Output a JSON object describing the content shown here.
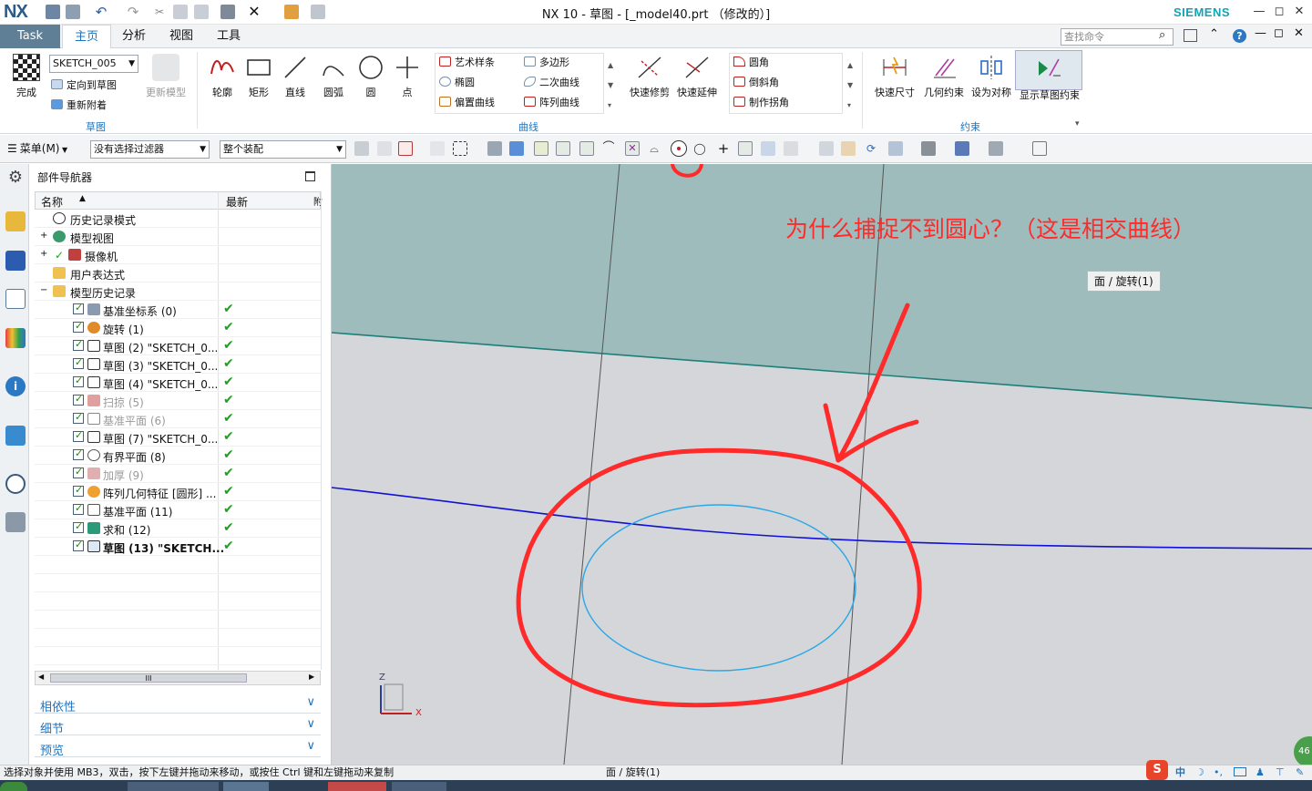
{
  "app": {
    "logo": "NX",
    "title": "NX 10 - 草图 - [_model40.prt （修改的）]",
    "brand": "SIEMENS",
    "window_buttons": [
      "—",
      "◻",
      "✕"
    ]
  },
  "ribbon_tabs": [
    "Task",
    "主页",
    "分析",
    "视图",
    "工具"
  ],
  "command_search": {
    "placeholder": "查找命令"
  },
  "ribbon": {
    "sketch_group": {
      "finish": "完成",
      "sketch_name": "SKETCH_005",
      "orient": "定向到草图",
      "reattach": "重新附着",
      "update_model": "更新模型",
      "label": "草图"
    },
    "curve_group": {
      "big": [
        "轮廓",
        "矩形",
        "直线",
        "圆弧",
        "圆",
        "点"
      ],
      "col1": [
        "艺术样条",
        "椭圆",
        "偏置曲线"
      ],
      "col2": [
        "多边形",
        "二次曲线",
        "阵列曲线"
      ],
      "trim": "快速修剪",
      "extend": "快速延伸",
      "col3": [
        "圆角",
        "倒斜角",
        "制作拐角"
      ],
      "label": "曲线"
    },
    "constraint_group": {
      "items": [
        "快速尺寸",
        "几何约束",
        "设为对称",
        "显示草图约束"
      ],
      "label": "约束"
    }
  },
  "toolbar": {
    "menu": "菜单(M)",
    "filter": "没有选择过滤器",
    "scope": "整个装配"
  },
  "navigator": {
    "title": "部件导航器",
    "col_name": "名称",
    "col_latest": "最新",
    "col_more": "附",
    "rows": [
      {
        "label": "历史记录模式"
      },
      {
        "label": "模型视图"
      },
      {
        "label": "摄像机"
      },
      {
        "label": "用户表达式"
      },
      {
        "label": "模型历史记录"
      },
      {
        "label": "基准坐标系 (0)"
      },
      {
        "label": "旋转 (1)"
      },
      {
        "label": "草图 (2) \"SKETCH_0..."
      },
      {
        "label": "草图 (3) \"SKETCH_0..."
      },
      {
        "label": "草图 (4) \"SKETCH_0..."
      },
      {
        "label": "扫掠 (5)"
      },
      {
        "label": "基准平面 (6)"
      },
      {
        "label": "草图 (7) \"SKETCH_0..."
      },
      {
        "label": "有界平面 (8)"
      },
      {
        "label": "加厚 (9)"
      },
      {
        "label": "阵列几何特征 [圆形] ..."
      },
      {
        "label": "基准平面 (11)"
      },
      {
        "label": "求和 (12)"
      },
      {
        "label": "草图 (13) \"SKETCH..."
      }
    ],
    "panels": [
      "相依性",
      "细节",
      "预览"
    ],
    "hscroll_grip": "III"
  },
  "viewport": {
    "annotation": "为什么捕捉不到圆心？（这是相交曲线）",
    "tooltip": "面 / 旋转(1)",
    "axis_z": "Z",
    "axis_x": "X",
    "corner_badge": "46"
  },
  "status": {
    "message": "选择对象并使用 MB3，双击，按下左键并拖动来移动，或按住 Ctrl 键和左键拖动来复制",
    "selection": "面 / 旋转(1)",
    "ime": [
      "S",
      "中"
    ]
  },
  "colors": {
    "accent": "#1e73be",
    "annotation_red": "#ff2a2a",
    "upper_face": "#9fbcbc",
    "lower_face": "#d4d6d9",
    "teal_edge": "#1d7f7a",
    "blue_curve": "#1010d8",
    "cyan_ellipse": "#2aa7e6",
    "check_green": "#1aa31a"
  }
}
